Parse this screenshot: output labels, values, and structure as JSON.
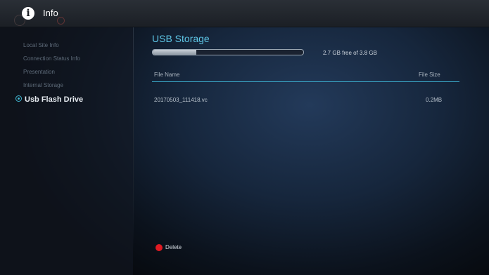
{
  "header": {
    "icon": "info-icon",
    "title": "Info"
  },
  "sidebar": {
    "items": [
      {
        "label": "Local Site Info",
        "active": false
      },
      {
        "label": "Connection Status Info",
        "active": false
      },
      {
        "label": "Presentation",
        "active": false
      },
      {
        "label": "Internal Storage",
        "active": false
      },
      {
        "label": "Usb Flash Drive",
        "active": true
      }
    ]
  },
  "main": {
    "title": "USB Storage",
    "storage": {
      "used_fraction": 0.29,
      "text": "2.7 GB free of 3.8 GB"
    },
    "table": {
      "columns": [
        "File Name",
        "File Size"
      ],
      "rows": [
        {
          "name": "20170503_111418.vc",
          "size": "0.2MB"
        }
      ]
    },
    "actions": {
      "delete_label": "Delete"
    }
  },
  "colors": {
    "accent": "#5ec6e6",
    "delete": "#e01a22"
  }
}
